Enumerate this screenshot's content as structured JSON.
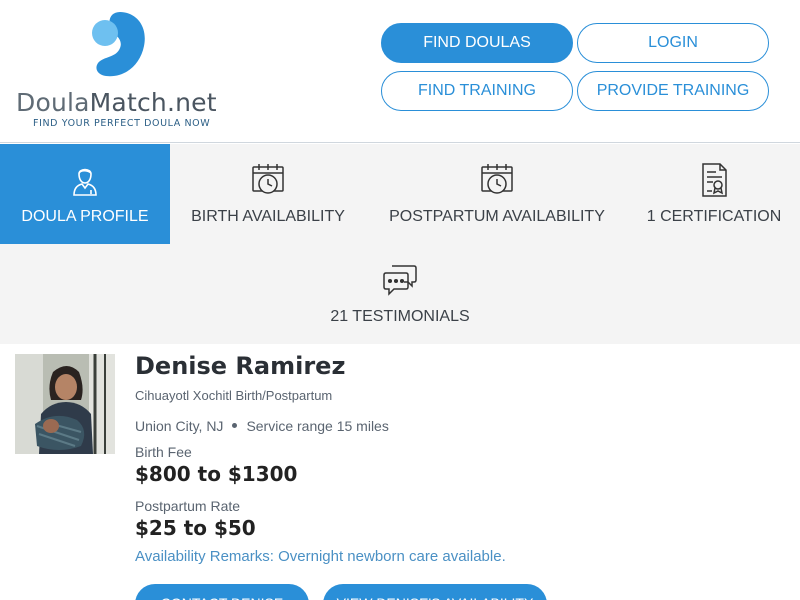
{
  "brand": {
    "name_part1": "Doula",
    "name_part2": "Match.net",
    "tagline": "FIND YOUR PERFECT DOULA NOW",
    "color": "#2a8fd8"
  },
  "nav": {
    "find_doulas": "FIND DOULAS",
    "login": "LOGIN",
    "find_training": "FIND TRAINING",
    "provide_training": "PROVIDE TRAINING"
  },
  "tabs": [
    {
      "label": "DOULA PROFILE",
      "icon": "person-icon",
      "active": true
    },
    {
      "label": "BIRTH AVAILABILITY",
      "icon": "calendar-clock-icon",
      "active": false
    },
    {
      "label": "POSTPARTUM AVAILABILITY",
      "icon": "calendar-clock-icon",
      "active": false
    },
    {
      "label": "1 CERTIFICATION",
      "icon": "certificate-icon",
      "active": false
    },
    {
      "label": "21 TESTIMONIALS",
      "icon": "chat-bubbles-icon",
      "active": false
    }
  ],
  "profile": {
    "name": "Denise Ramirez",
    "business": "Cihuayotl Xochitl Birth/Postpartum",
    "location": "Union City, NJ",
    "service_range": "Service range 15 miles",
    "birth_fee_label": "Birth Fee",
    "birth_fee": "$800 to $1300",
    "postpartum_label": "Postpartum Rate",
    "postpartum_rate": "$25 to $50",
    "remarks": "Availability Remarks: Overnight newborn care available."
  },
  "actions": {
    "contact": "CONTACT DENISE",
    "availability": "VIEW DENISE'S AVAILABILITY"
  }
}
